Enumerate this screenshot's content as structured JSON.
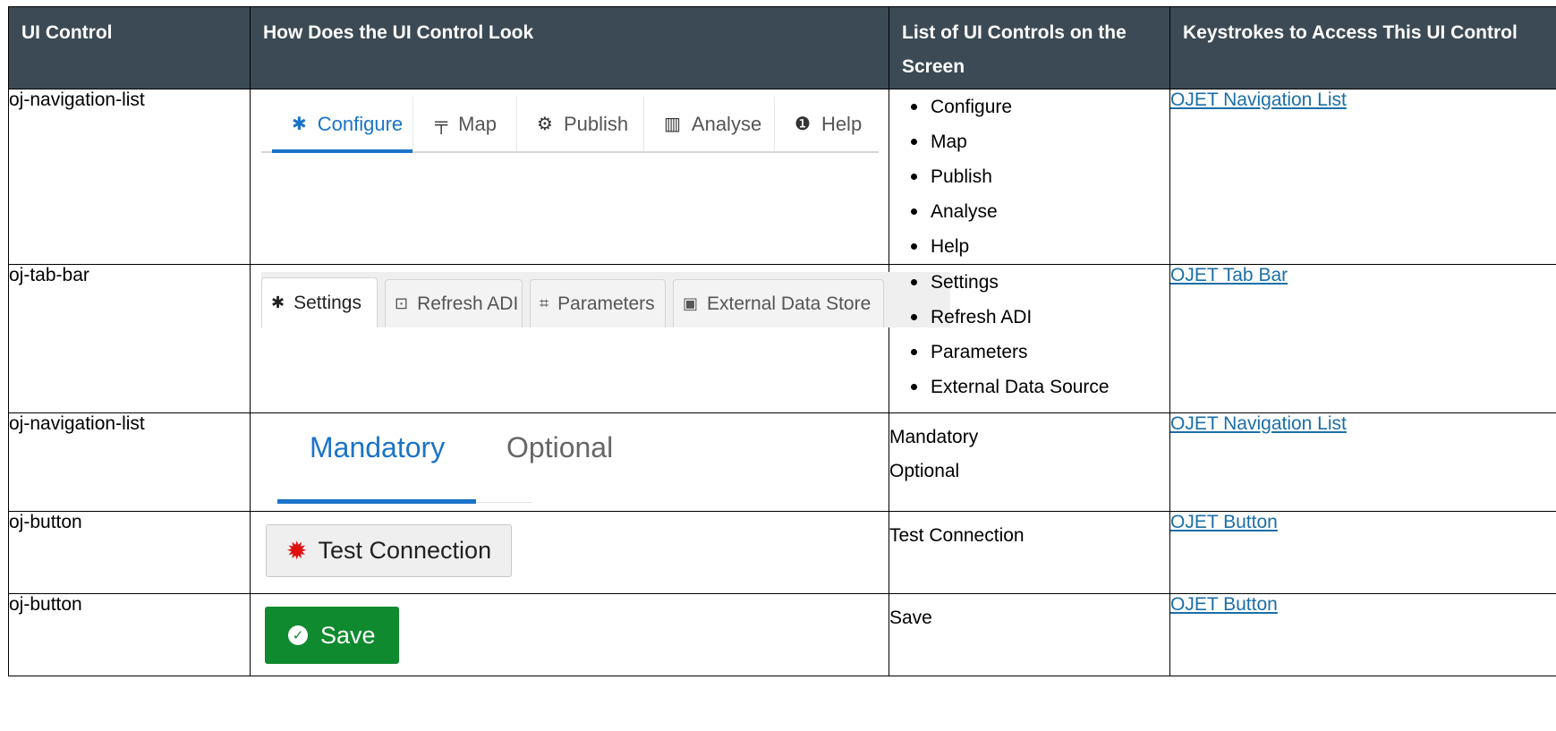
{
  "headers": [
    "UI Control",
    "How Does the UI Control Look",
    "List of UI Controls on the Screen",
    "Keystrokes to Access This UI Control"
  ],
  "rows": [
    {
      "control": "oj-navigation-list",
      "preview": {
        "tabs": [
          {
            "label": "Configure",
            "icon": "gear-icon"
          },
          {
            "label": "Map",
            "icon": "signpost-icon"
          },
          {
            "label": "Publish",
            "icon": "cogs-icon"
          },
          {
            "label": "Analyse",
            "icon": "bar-chart-icon"
          },
          {
            "label": "Help",
            "icon": "info-icon"
          }
        ],
        "selected": "Configure"
      },
      "list": [
        "Configure",
        "Map",
        "Publish",
        "Analyse",
        "Help"
      ],
      "link": "OJET Navigation List"
    },
    {
      "control": "oj-tab-bar",
      "preview": {
        "tabs": [
          {
            "label": "Settings",
            "icon": "gear-icon"
          },
          {
            "label": "Refresh ADI",
            "icon": "refresh-box-icon"
          },
          {
            "label": "Parameters",
            "icon": "crop-icon"
          },
          {
            "label": "External Data Store",
            "icon": "briefcase-icon"
          }
        ],
        "selected": "Settings"
      },
      "list": [
        "Settings",
        "Refresh ADI",
        "Parameters",
        "External Data Source"
      ],
      "link": "OJET Tab Bar"
    },
    {
      "control": "oj-navigation-list",
      "preview": {
        "tabs": [
          {
            "label": "Mandatory"
          },
          {
            "label": "Optional"
          }
        ],
        "selected": "Mandatory"
      },
      "list_plain": [
        "Mandatory",
        "Optional"
      ],
      "link": "OJET Navigation List"
    },
    {
      "control": "oj-button",
      "preview": {
        "label": "Test Connection",
        "icon": "gear-icon",
        "icon_color": "#e01010"
      },
      "list_plain": [
        "Test Connection"
      ],
      "link": "OJET Button"
    },
    {
      "control": "oj-button",
      "preview": {
        "label": "Save",
        "icon": "check-circle-icon",
        "bg_color": "#0f8a2e"
      },
      "list_plain": [
        "Save"
      ],
      "link": "OJET Button"
    }
  ],
  "colors": {
    "header_bg": "#3b4a54",
    "link": "#1b6fa7",
    "accent": "#1a73c8"
  }
}
